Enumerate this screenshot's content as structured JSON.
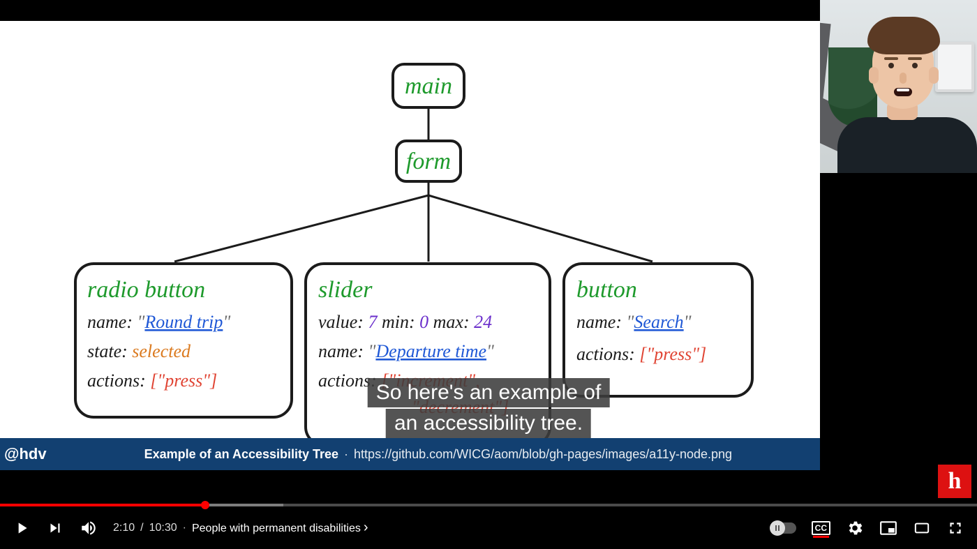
{
  "slide": {
    "handle": "@hdv",
    "title": "Example of an Accessibility Tree",
    "url": "https://github.com/WICG/aom/blob/gh-pages/images/a11y-node.png",
    "tree": {
      "root": "main",
      "child": "form",
      "leaves": {
        "radio": {
          "role": "radio button",
          "name": "Round trip",
          "state": "selected",
          "actions": "[\"press\"]"
        },
        "slider": {
          "role": "slider",
          "value_label": "value:",
          "value": "7",
          "min_label": "min:",
          "min": "0",
          "max_label": "max:",
          "max": "24",
          "name": "Departure time",
          "actions_l1": "[\"increment\",",
          "actions_l2": "\"decrement\"]"
        },
        "button": {
          "role": "button",
          "name": "Search",
          "actions": "[\"press\"]"
        }
      },
      "labels": {
        "name": "name:",
        "state": "state:",
        "actions": "actions:"
      }
    }
  },
  "captions": {
    "line1": "So here's an example of",
    "line2": "an accessibility tree."
  },
  "player": {
    "currentTime": "2:10",
    "duration": "10:30",
    "separator": "/",
    "chapter_prefix": "·",
    "chapter": "People with permanent disabilities",
    "cc_label": "CC",
    "progress_played_pct": 21,
    "progress_buffered_pct": 29
  },
  "logo": {
    "letter": "h"
  }
}
